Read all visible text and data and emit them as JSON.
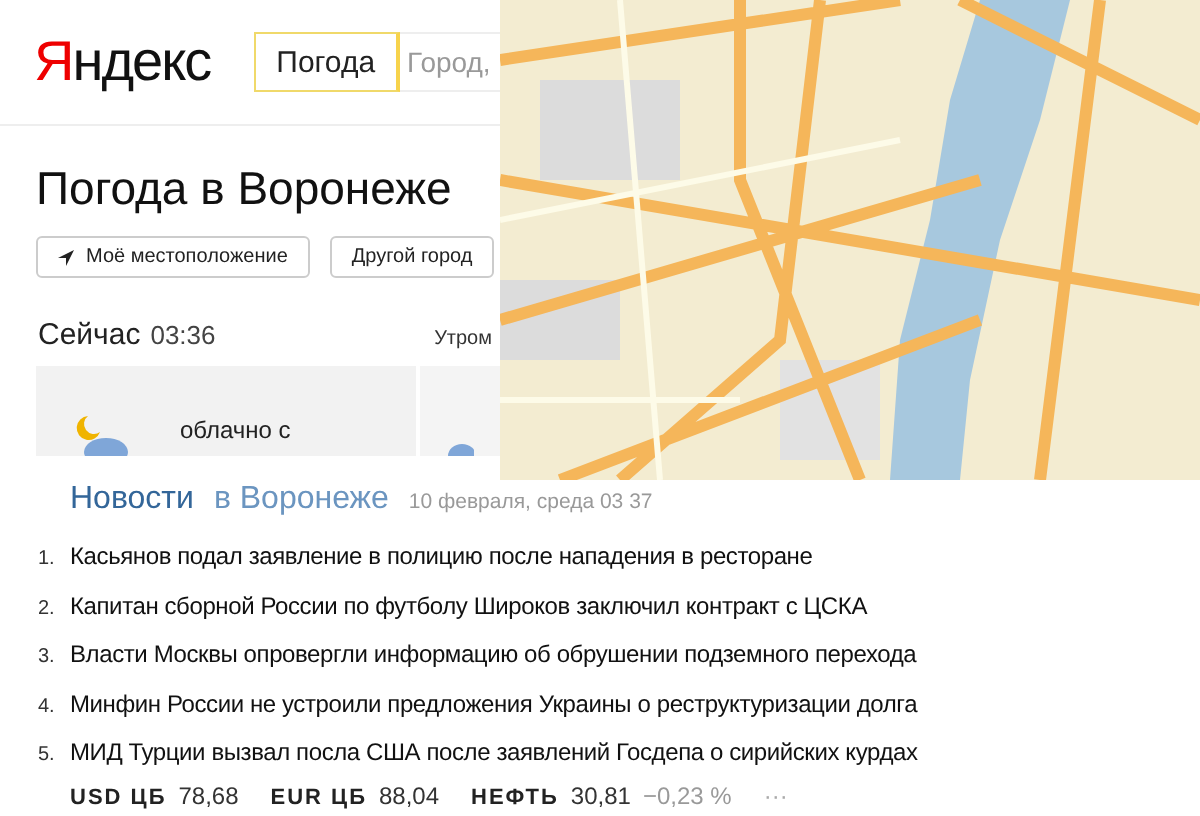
{
  "header": {
    "logo": "Яндекс",
    "service_tab": {
      "label": "Погода",
      "selected": true
    },
    "search": {
      "placeholder": "Город,"
    }
  },
  "title": "Погода в Воронеже",
  "location_buttons": [
    "Моё местоположение",
    "Другой город"
  ],
  "now": {
    "label": "Сейчас",
    "time": "03:36",
    "next_label": "Утром",
    "condition": "облачно с"
  },
  "map": {
    "kind": "picture"
  },
  "news": {
    "title": "Новости",
    "region": "в Воронеже",
    "date": "10 февраля, среда 03 37",
    "items": [
      {
        "number": "1.",
        "text": "Касьянов подал заявление в полицию после нападения в ресторане"
      },
      {
        "number": "2.",
        "text": "Капитан сборной России по футболу Широков заключил контракт с ЦСКА"
      },
      {
        "number": "3.",
        "text": "Власти Москвы опровергли информацию об обрушении подземного перехода"
      },
      {
        "number": "4.",
        "text": "Минфин России не устроили предложения Украины о реструктуризации долга"
      },
      {
        "number": "5.",
        "text": "МИД Турции вызвал посла США после заявлений Госдепа о сирийских курдах"
      }
    ]
  },
  "quotes": [
    {
      "name": "USD ЦБ",
      "value": "78,68"
    },
    {
      "name": "EUR ЦБ",
      "value": "88,04"
    },
    {
      "name": "НЕФТЬ",
      "value": "30,81",
      "change": "−0,23 %"
    }
  ],
  "more": "···"
}
